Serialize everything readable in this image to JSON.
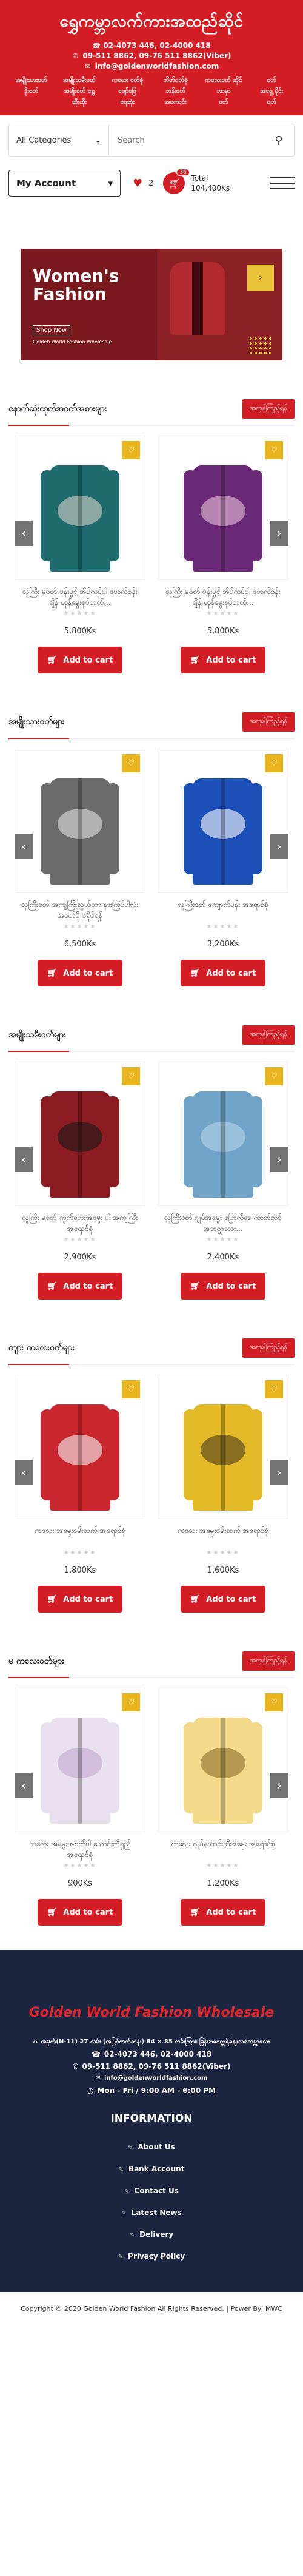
{
  "header": {
    "brand": "ရွှေကမ္ဘာလက်ကားအထည်ဆိုင်",
    "phone1": "02-4073 446, 02-4000 418",
    "phone2": "09-511 8862, 09-76 511 8862(Viber)",
    "email": "info@goldenworldfashion.com"
  },
  "nav": [
    "အမျိုးသားဝတ်",
    "အမျိုးသမီးဝတ်",
    "ကလေး ဝတ်စုံ",
    "ဘိတ်ဝတ်စုံ",
    "ကလေးဝတ် ဆိုင်",
    "ဝတ်",
    "ဒိုးဝတ်",
    "အမျိုးဝတ် ရွှေ",
    "ဖျော်ဖြေ",
    "ဘန်းဝတ်",
    "ဘာမှာ",
    "အရှေ့ ပိုင်း",
    "",
    "ဆိုးထိုး",
    "ရေဆုံး",
    "အကောင်း",
    "ဝတ်",
    "ဝတ်"
  ],
  "search": {
    "category": "All Categories",
    "placeholder": "Search"
  },
  "account": {
    "label": "My Account",
    "wish_count": "2",
    "cart_badge": "36",
    "total_label": "Total",
    "total_value": "104,400Ks"
  },
  "banner": {
    "heading": "Women's Fashion",
    "shop": "Shop Now",
    "sub": "Golden World Fashion Wholesale"
  },
  "view_all": "အကုန်ကြည့်ရန်",
  "add_to_cart": "Add to cart",
  "sections": [
    {
      "title": "နောက်ဆုံးထုတ်အဝတ်အစားများ",
      "products": [
        {
          "name": "လူကြီး မဝတ် ပန်းပွင့် အိပ်ကပ်ပါ ဖောက်ဝန်းချိန် ယုန်မွေးစုပ်ဘတ်...",
          "price": "5,800Ks",
          "color": "#1f6b6e",
          "pat": "#d6d0c4"
        },
        {
          "name": "လူကြီး မဝတ် ပန်းပွင့် အိပ်ကပ်ပါ ဖောက်ဝန်းချိန် ယုန်မွေးစုပ်ဘတ်...",
          "price": "5,800Ks",
          "color": "#6b2a78",
          "pat": "#e8c3d8"
        }
      ]
    },
    {
      "title": "အမျိုးသားဝတ်များ",
      "products": [
        {
          "name": "လူကြီးဝတ် အကျင်္ကြီးဆွယ်တာ နားကြပ်ပါလုံးအဝတ်ပို ခရိုင်ရန်",
          "price": "6,500Ks",
          "color": "#6b6b6b",
          "pat": "#e0e0e0"
        },
        {
          "name": "လူကြီးဝတ် ကျောက်ပန်း အရောင်စုံ",
          "price": "3,200Ks",
          "color": "#1d4fb8",
          "pat": "#ffffff"
        }
      ]
    },
    {
      "title": "အမျိုးသမီးဝတ်များ",
      "products": [
        {
          "name": "လူကြီး မဝတ် ကွက်လေးအမွေး ပါ အကျင်္ကြီးအရောင်စုံ",
          "price": "2,900Ks",
          "color": "#8a1c22",
          "pat": "#1a1a1a"
        },
        {
          "name": "လူကြီးဝတ် ဂျုပ်အမွေး ပြောက်ဒေ ကာတ်တစ် အဘတ္တသား...",
          "price": "2,400Ks",
          "color": "#6fa3c8",
          "pat": "#b8d4e8"
        }
      ]
    },
    {
      "title": "ကျား ကလေးဝတ်များ",
      "products": [
        {
          "name": "ကလေး အမွေးဝမ်းဆက် အရောင်စုံ",
          "price": "1,800Ks",
          "color": "#c9272d",
          "pat": "#f3f3f3"
        },
        {
          "name": "ကလေး အမွေးဝမ်းဆက် အရောင်စုံ",
          "price": "1,600Ks",
          "color": "#e2b826",
          "pat": "#4a3a1a"
        }
      ]
    },
    {
      "title": "မ ကလေးဝတ်များ",
      "products": [
        {
          "name": "ကလေး အမွေးအစက်ပါ ဘောင်းဘီရှည် အရောင်စုံ",
          "price": "900Ks",
          "color": "#e8e0ee",
          "pat": "#c3a5cf"
        },
        {
          "name": "ကလေး ဂျုပ်ဘောင်းဘီအမွေး အရောင်စုံ",
          "price": "1,200Ks",
          "color": "#f2d98a",
          "pat": "#8a6d2a"
        }
      ]
    }
  ],
  "footer": {
    "brand": "Golden World Fashion Wholesale",
    "address": "အမှတ်(N-11) 27 လမ်း (အပြင်ဘက်တန်း) 84 × 85 လမ်းကြား၊ မြန်မာစေတ္တရိဈေးသစ်ကမ္ဘာလေး",
    "phone1": "02-4073 446, 02-4000 418",
    "phone2": "09-511 8862, 09-76 511 8862(Viber)",
    "email": "info@goldenworldfashion.com",
    "hours": "Mon - Fri / 9:00 AM - 6:00 PM",
    "info_heading": "INFORMATION",
    "links": [
      "About Us",
      "Bank Account",
      "Contact Us",
      "Latest News",
      "Delivery",
      "Privacy Policy"
    ]
  },
  "copyright": {
    "text": "Copyright © 2020 Golden World Fashion All Rights Reserved.",
    "power": "Power By: MWC"
  }
}
